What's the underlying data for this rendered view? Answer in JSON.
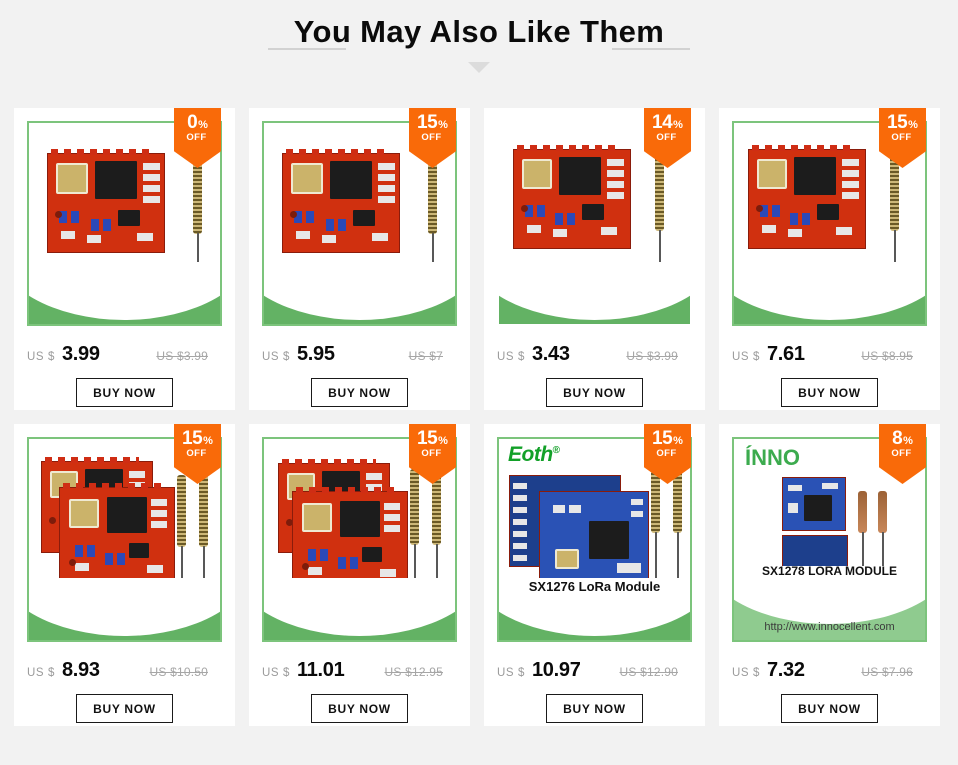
{
  "header": {
    "title": "You May Also Like Them",
    "caret_icon": "triangle-down-icon"
  },
  "labels": {
    "currency": "US $",
    "percent_symbol": "%",
    "off_label": "OFF",
    "buy_now": "BUY NOW"
  },
  "products": [
    {
      "discount": "0",
      "price": "3.99",
      "original_price": "US $3.99",
      "buy_label": "BUY NOW",
      "art": "rf-module-single",
      "bordered": true
    },
    {
      "discount": "15",
      "price": "5.95",
      "original_price": "US $7",
      "buy_label": "BUY NOW",
      "art": "rf-module-single",
      "bordered": true
    },
    {
      "discount": "14",
      "price": "3.43",
      "original_price": "US $3.99",
      "buy_label": "BUY NOW",
      "art": "rf-module-single",
      "bordered": true
    },
    {
      "discount": "15",
      "price": "7.61",
      "original_price": "US $8.95",
      "buy_label": "BUY NOW",
      "art": "rf-module-single",
      "bordered": true
    },
    {
      "discount": "15",
      "price": "8.93",
      "original_price": "US $10.50",
      "buy_label": "BUY NOW",
      "art": "rf-module-pair",
      "bordered": true
    },
    {
      "discount": "15",
      "price": "11.01",
      "original_price": "US $12.95",
      "buy_label": "BUY NOW",
      "art": "rf-module-pair",
      "bordered": true
    },
    {
      "discount": "15",
      "price": "10.97",
      "original_price": "US $12.90",
      "buy_label": "BUY NOW",
      "art": "lora-eoth",
      "bordered": true,
      "brand": "Eoth",
      "brand_mark": "®",
      "caption": "SX1276 LoRa Module"
    },
    {
      "discount": "8",
      "price": "7.32",
      "original_price": "US $7.96",
      "buy_label": "BUY NOW",
      "art": "lora-inno",
      "bordered": true,
      "brand": "ÍNNO",
      "caption": "SX1278 LORA MODULE",
      "url": "http://www.innocellent.com"
    }
  ],
  "colors": {
    "background": "#f2f2f2",
    "card": "#ffffff",
    "badge": "#f96a09",
    "green_border": "#7cc47c",
    "green_wave": "#63b264",
    "brand_green": "#12a028"
  }
}
